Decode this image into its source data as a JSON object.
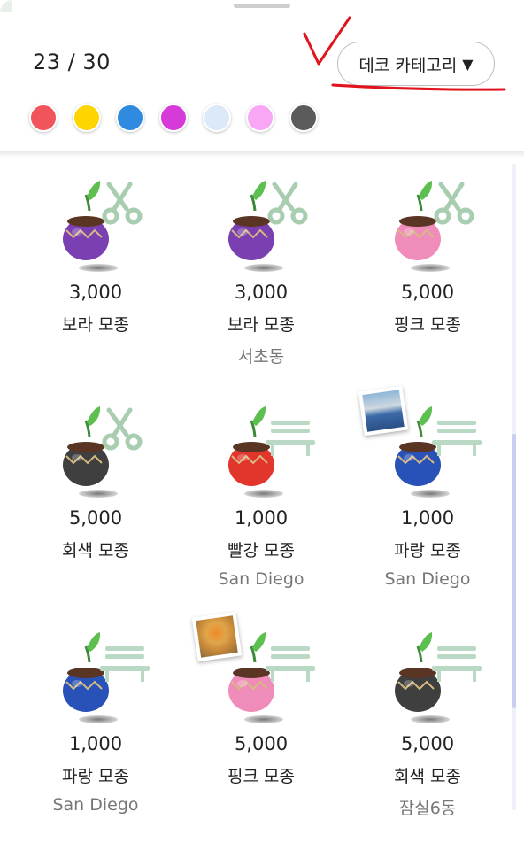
{
  "header": {
    "counter": "23 / 30",
    "category_label": "데코 카테고리",
    "category_arrow": "▼"
  },
  "colors": [
    "#f2545b",
    "#ffd500",
    "#2f8ae0",
    "#d63ad8",
    "#dce9f8",
    "#f9a6f5",
    "#5b5b5b"
  ],
  "items": [
    {
      "price": "3,000",
      "name": "보라 모종",
      "location": "",
      "pot_color": "#7a3fb0",
      "tool": "scissors-icon",
      "photo": ""
    },
    {
      "price": "3,000",
      "name": "보라 모종",
      "location": "서초동",
      "pot_color": "#7a3fb0",
      "tool": "scissors-icon",
      "photo": ""
    },
    {
      "price": "5,000",
      "name": "핑크 모종",
      "location": "",
      "pot_color": "#f08cba",
      "tool": "scissors-icon",
      "photo": ""
    },
    {
      "price": "5,000",
      "name": "회색 모종",
      "location": "",
      "pot_color": "#3f3f3f",
      "tool": "scissors-icon",
      "photo": ""
    },
    {
      "price": "1,000",
      "name": "빨강 모종",
      "location": "San Diego",
      "pot_color": "#e2352c",
      "tool": "bench-icon",
      "photo": ""
    },
    {
      "price": "1,000",
      "name": "파랑 모종",
      "location": "San Diego",
      "pot_color": "#2952b8",
      "tool": "bench-icon",
      "photo": "harbor-photo"
    },
    {
      "price": "1,000",
      "name": "파랑 모종",
      "location": "San Diego",
      "pot_color": "#2952b8",
      "tool": "bench-icon",
      "photo": ""
    },
    {
      "price": "5,000",
      "name": "핑크 모종",
      "location": "",
      "pot_color": "#f08cba",
      "tool": "bench-icon",
      "photo": "food-photo"
    },
    {
      "price": "5,000",
      "name": "회색 모종",
      "location": "잠실6동",
      "pot_color": "#3f3f3f",
      "tool": "bench-icon",
      "photo": ""
    }
  ]
}
